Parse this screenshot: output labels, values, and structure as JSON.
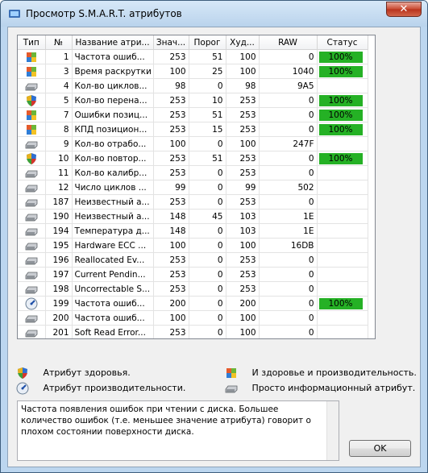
{
  "window": {
    "title": "Просмотр S.M.A.R.T. атрибутов",
    "close_glyph": "✕"
  },
  "columns": [
    "Тип",
    "№",
    "Название атри...",
    "Знач...",
    "Порог",
    "Худ...",
    "RAW",
    "Статус"
  ],
  "rows": [
    {
      "icon": "both",
      "num": "1",
      "name": "Частота ошиб...",
      "value": "253",
      "threshold": "51",
      "worst": "100",
      "raw": "0",
      "status": "100%"
    },
    {
      "icon": "both",
      "num": "3",
      "name": "Время раскрутки",
      "value": "100",
      "threshold": "25",
      "worst": "100",
      "raw": "1040",
      "status": "100%"
    },
    {
      "icon": "info",
      "num": "4",
      "name": "Кол-во циклов...",
      "value": "98",
      "threshold": "0",
      "worst": "98",
      "raw": "9A5",
      "status": ""
    },
    {
      "icon": "health",
      "num": "5",
      "name": "Кол-во перена...",
      "value": "253",
      "threshold": "10",
      "worst": "253",
      "raw": "0",
      "status": "100%"
    },
    {
      "icon": "both",
      "num": "7",
      "name": "Ошибки позиц...",
      "value": "253",
      "threshold": "51",
      "worst": "253",
      "raw": "0",
      "status": "100%"
    },
    {
      "icon": "both",
      "num": "8",
      "name": "КПД позицион...",
      "value": "253",
      "threshold": "15",
      "worst": "253",
      "raw": "0",
      "status": "100%"
    },
    {
      "icon": "info",
      "num": "9",
      "name": "Кол-во отрабо...",
      "value": "100",
      "threshold": "0",
      "worst": "100",
      "raw": "247F",
      "status": ""
    },
    {
      "icon": "health",
      "num": "10",
      "name": "Кол-во повтор...",
      "value": "253",
      "threshold": "51",
      "worst": "253",
      "raw": "0",
      "status": "100%"
    },
    {
      "icon": "info",
      "num": "11",
      "name": "Кол-во калибр...",
      "value": "253",
      "threshold": "0",
      "worst": "253",
      "raw": "0",
      "status": ""
    },
    {
      "icon": "info",
      "num": "12",
      "name": "Число циклов ...",
      "value": "99",
      "threshold": "0",
      "worst": "99",
      "raw": "502",
      "status": ""
    },
    {
      "icon": "info",
      "num": "187",
      "name": "Неизвестный а...",
      "value": "253",
      "threshold": "0",
      "worst": "253",
      "raw": "0",
      "status": ""
    },
    {
      "icon": "info",
      "num": "190",
      "name": "Неизвестный а...",
      "value": "148",
      "threshold": "45",
      "worst": "103",
      "raw": "1E",
      "status": ""
    },
    {
      "icon": "info",
      "num": "194",
      "name": "Температура д...",
      "value": "148",
      "threshold": "0",
      "worst": "103",
      "raw": "1E",
      "status": ""
    },
    {
      "icon": "info",
      "num": "195",
      "name": "Hardware ECC ...",
      "value": "100",
      "threshold": "0",
      "worst": "100",
      "raw": "16DB",
      "status": ""
    },
    {
      "icon": "info",
      "num": "196",
      "name": "Reallocated Ev...",
      "value": "253",
      "threshold": "0",
      "worst": "253",
      "raw": "0",
      "status": ""
    },
    {
      "icon": "info",
      "num": "197",
      "name": "Current Pendin...",
      "value": "253",
      "threshold": "0",
      "worst": "253",
      "raw": "0",
      "status": ""
    },
    {
      "icon": "info",
      "num": "198",
      "name": "Uncorrectable S...",
      "value": "253",
      "threshold": "0",
      "worst": "253",
      "raw": "0",
      "status": ""
    },
    {
      "icon": "perf",
      "num": "199",
      "name": "Частота ошиб...",
      "value": "200",
      "threshold": "0",
      "worst": "200",
      "raw": "0",
      "status": "100%"
    },
    {
      "icon": "info",
      "num": "200",
      "name": "Частота ошиб...",
      "value": "100",
      "threshold": "0",
      "worst": "100",
      "raw": "0",
      "status": ""
    },
    {
      "icon": "info",
      "num": "201",
      "name": "Soft Read Error...",
      "value": "253",
      "threshold": "0",
      "worst": "100",
      "raw": "0",
      "status": ""
    }
  ],
  "legend": {
    "health": "Атрибут здоровья.",
    "perf": "Атрибут производительности.",
    "both": "И здоровье и производительность.",
    "info": "Просто информационный атрибут."
  },
  "description": "Частота появления ошибок при чтении с диска. Большее количество ошибок (т.е. меньшее значение атрибута) говорит о плохом состоянии поверхности диска.",
  "ok_label": "OK",
  "colors": {
    "status_green": "#25b125",
    "titlebar": "#c6dcf2",
    "close_red": "#c8482f"
  }
}
